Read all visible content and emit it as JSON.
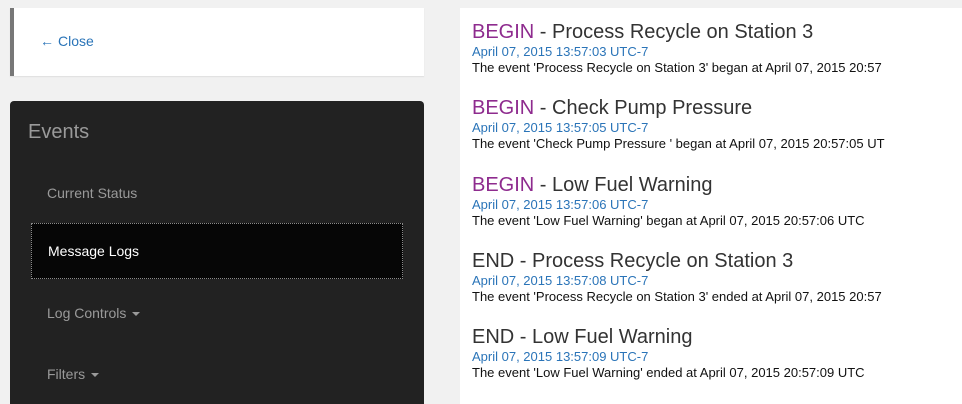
{
  "close": {
    "arrow": "←",
    "label": "Close"
  },
  "sidebar": {
    "title": "Events",
    "items": [
      {
        "label": "Current Status",
        "active": false,
        "dropdown": false
      },
      {
        "label": "Message Logs",
        "active": true,
        "dropdown": false
      },
      {
        "label": "Log Controls",
        "active": false,
        "dropdown": true
      },
      {
        "label": "Filters",
        "active": false,
        "dropdown": true
      }
    ]
  },
  "logs": [
    {
      "tag": "BEGIN",
      "title": " - Process Recycle on Station 3",
      "time": "April 07, 2015 13:57:03 UTC-7",
      "message": "The event 'Process Recycle on Station 3' began at April 07, 2015 20:57"
    },
    {
      "tag": "BEGIN",
      "title": " - Check Pump Pressure",
      "time": "April 07, 2015 13:57:05 UTC-7",
      "message": "The event 'Check Pump Pressure ' began at April 07, 2015 20:57:05 UT"
    },
    {
      "tag": "BEGIN",
      "title": " - Low Fuel Warning",
      "time": "April 07, 2015 13:57:06 UTC-7",
      "message": "The event 'Low Fuel Warning' began at April 07, 2015 20:57:06 UTC"
    },
    {
      "tag": "END",
      "title": " - Process Recycle on Station 3",
      "time": "April 07, 2015 13:57:08 UTC-7",
      "message": "The event 'Process Recycle on Station 3' ended at April 07, 2015 20:57"
    },
    {
      "tag": "END",
      "title": " - Low Fuel Warning",
      "time": "April 07, 2015 13:57:09 UTC-7",
      "message": "The event 'Low Fuel Warning' ended at April 07, 2015 20:57:09 UTC"
    }
  ],
  "colors": {
    "begin_tag": "#8e2b8e",
    "link": "#2a74b8",
    "sidebar_bg": "#222222",
    "active_bg": "#060606"
  },
  "icons": {
    "close": "left-arrow-icon",
    "dropdown": "caret-down-icon"
  }
}
